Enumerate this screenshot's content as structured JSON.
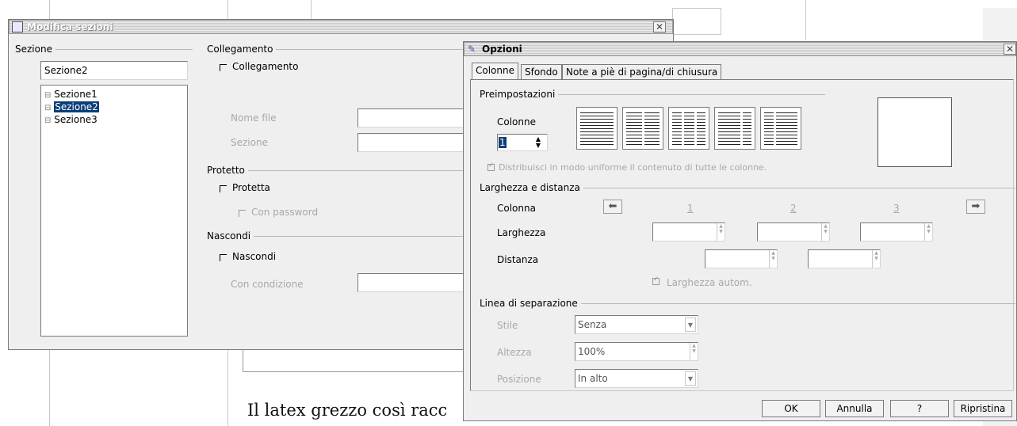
{
  "document": {
    "body_text": "Il latex grezzo così racc"
  },
  "sections_dialog": {
    "title": "Modifica sezioni",
    "section_group_label": "Sezione",
    "section_name_value": "Sezione2",
    "sections": [
      {
        "label": "Sezione1",
        "selected": false
      },
      {
        "label": "Sezione2",
        "selected": true
      },
      {
        "label": "Sezione3",
        "selected": false
      }
    ],
    "link_group_label": "Collegamento",
    "link_checkbox_label": "Collegamento",
    "file_name_label": "Nome file",
    "section_label": "Sezione",
    "protected_group_label": "Protetto",
    "protected_checkbox_label": "Protetta",
    "password_checkbox_label": "Con password",
    "hide_group_label": "Nascondi",
    "hide_checkbox_label": "Nascondi",
    "condition_label": "Con condizione"
  },
  "options_dialog": {
    "title": "Opzioni",
    "tabs": [
      {
        "label": "Colonne",
        "active": true
      },
      {
        "label": "Sfondo",
        "active": false
      },
      {
        "label": "Note a piè di pagina/di chiusura",
        "active": false
      }
    ],
    "presets_group_label": "Preimpostazioni",
    "columns_label": "Colonne",
    "columns_value": "1",
    "distribute_label": "Distribuisci in modo uniforme il contenuto di tutte le colonne.",
    "width_spacing_group_label": "Larghezza e distanza",
    "column_row_label": "Colonna",
    "column_numbers": [
      "1",
      "2",
      "3"
    ],
    "width_row_label": "Larghezza",
    "spacing_row_label": "Distanza",
    "auto_width_label": "Larghezza autom.",
    "separator_group_label": "Linea di separazione",
    "style_label": "Stile",
    "style_value": "Senza",
    "height_label": "Altezza",
    "height_value": "100%",
    "position_label": "Posizione",
    "position_value": "In alto",
    "buttons": {
      "ok": "OK",
      "cancel": "Annulla",
      "help": "?",
      "reset": "Ripristina"
    },
    "icons": {
      "left_arrow": "left-arrow-icon",
      "right_arrow": "right-arrow-icon"
    }
  }
}
